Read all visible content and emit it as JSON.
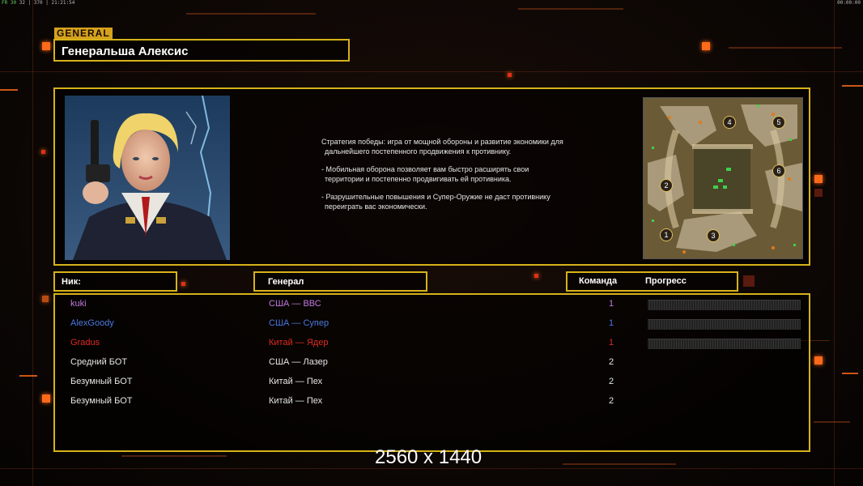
{
  "hud": {
    "fps_label": "FR",
    "fps_value": "30",
    "stats": "32 | 370 | 21:21:54",
    "clock": "00:00:00"
  },
  "general": {
    "tag": "GENERAL",
    "name": "Генеральша Алексис"
  },
  "strategy": [
    "Стратегия победы: игра от мощной обороны и развитие экономики для дальнейшего постепенного продвижения к противнику.",
    "- Мобильная оборона позволяет вам быстро расширять свои территории и постепенно продвигивать ей противника.",
    "- Разрушительные повышения и Супер-Оружие не даст противнику переиграть вас экономически."
  ],
  "minimap": {
    "start_positions": [
      "1",
      "2",
      "3",
      "4",
      "5",
      "6"
    ]
  },
  "columns": {
    "nick": "Ник:",
    "general": "Генерал",
    "team": "Команда",
    "progress": "Прогресс"
  },
  "players": [
    {
      "nick": "kuki",
      "general": "США — ВВС",
      "team": "1",
      "color": "#c07ae0",
      "has_progress": true
    },
    {
      "nick": "AlexGoody",
      "general": "США — Супер",
      "team": "1",
      "color": "#4a78e0",
      "has_progress": true
    },
    {
      "nick": "Gradus",
      "general": "Китай — Ядер",
      "team": "1",
      "color": "#e02a22",
      "has_progress": true
    },
    {
      "nick": "Средний БОТ",
      "general": "США — Лазер",
      "team": "2",
      "color": "#e6e6e6",
      "has_progress": false
    },
    {
      "nick": "Безумный БОТ",
      "general": "Китай — Пех",
      "team": "2",
      "color": "#e6e6e6",
      "has_progress": false
    },
    {
      "nick": "Безумный БОТ",
      "general": "Китай — Пех",
      "team": "2",
      "color": "#e6e6e6",
      "has_progress": false
    }
  ],
  "resolution": "2560 x 1440",
  "colors": {
    "accent": "#d6b21a",
    "glow": "#ff6a1a",
    "background": "#0a0605"
  }
}
